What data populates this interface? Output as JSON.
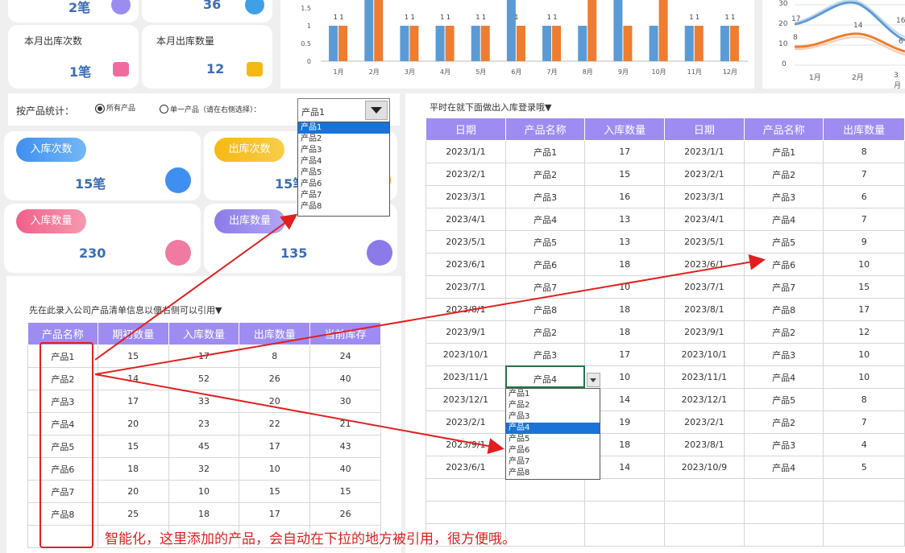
{
  "top_cards": {
    "outbound_count_label": "本月出库次数",
    "outbound_count_value": "1笔",
    "outbound_qty_label": "本月出库数量",
    "outbound_qty_value": "12",
    "cut_left_value": "2笔",
    "cut_right_value": "36"
  },
  "filter": {
    "label": "按产品统计：",
    "option_all": "所有产品",
    "option_single": "单一产品（请在右侧选择）：",
    "selected": "产品1",
    "options": [
      "产品1",
      "产品2",
      "产品3",
      "产品4",
      "产品5",
      "产品6",
      "产品7",
      "产品8"
    ]
  },
  "stats": {
    "in_count_label": "入库次数",
    "in_count_value": "15笔",
    "out_count_label": "出库次数",
    "out_count_value": "15笔",
    "in_qty_label": "入库数量",
    "in_qty_value": "230",
    "out_qty_label": "出库数量",
    "out_qty_value": "135"
  },
  "chart_data": {
    "type": "bar",
    "categories": [
      "1月",
      "2月",
      "3月",
      "4月",
      "5月",
      "6月",
      "7月",
      "8月",
      "9月",
      "10月",
      "11月",
      "12月"
    ],
    "series": [
      {
        "values": [
          1,
          2,
          1,
          1,
          1,
          2,
          1,
          1,
          2,
          1,
          1,
          1
        ],
        "color": "#5b9bd5"
      },
      {
        "values": [
          1,
          2,
          1,
          1,
          1,
          1,
          1,
          2,
          1,
          2,
          1,
          1
        ],
        "color": "#ed7d31"
      }
    ],
    "data_labels": [
      "1 1",
      "",
      "1 1",
      "1 1",
      "1 1",
      "1",
      "1 1",
      "",
      "",
      "",
      "1 1",
      "1 1"
    ],
    "yticks": [
      "1.5",
      "1",
      "0.5",
      "0"
    ],
    "ylim": [
      0,
      2
    ]
  },
  "line_chart": {
    "labels": [
      "17",
      "8",
      "14",
      "16",
      "6"
    ],
    "yticks": [
      "30",
      "20",
      "10",
      "0"
    ],
    "xticks": [
      "1月",
      "2月",
      "3月"
    ]
  },
  "product_section": {
    "title": "先在此录入公司产品清单信息以便右侧可以引用▼",
    "headers": [
      "产品名称",
      "期初数量",
      "入库数量",
      "出库数量",
      "当前库存"
    ],
    "rows": [
      [
        "产品1",
        "15",
        "17",
        "8",
        "24"
      ],
      [
        "产品2",
        "14",
        "52",
        "26",
        "40"
      ],
      [
        "产品3",
        "17",
        "33",
        "20",
        "30"
      ],
      [
        "产品4",
        "20",
        "23",
        "22",
        "21"
      ],
      [
        "产品5",
        "15",
        "45",
        "17",
        "43"
      ],
      [
        "产品6",
        "18",
        "32",
        "10",
        "40"
      ],
      [
        "产品7",
        "20",
        "10",
        "15",
        "15"
      ],
      [
        "产品8",
        "25",
        "18",
        "17",
        "26"
      ]
    ]
  },
  "records_section": {
    "title": "平时在就下面做出入库登录哦▼",
    "headers": [
      "日期",
      "产品名称",
      "入库数量",
      "日期",
      "产品名称",
      "出库数量"
    ],
    "rows": [
      [
        "2023/1/1",
        "产品1",
        "17",
        "2023/1/1",
        "产品1",
        "8"
      ],
      [
        "2023/2/1",
        "产品2",
        "15",
        "2023/2/1",
        "产品2",
        "7"
      ],
      [
        "2023/3/1",
        "产品3",
        "16",
        "2023/3/1",
        "产品3",
        "6"
      ],
      [
        "2023/4/1",
        "产品4",
        "13",
        "2023/4/1",
        "产品4",
        "7"
      ],
      [
        "2023/5/1",
        "产品5",
        "13",
        "2023/5/1",
        "产品5",
        "9"
      ],
      [
        "2023/6/1",
        "产品6",
        "18",
        "2023/6/1",
        "产品6",
        "10"
      ],
      [
        "2023/7/1",
        "产品7",
        "10",
        "2023/7/1",
        "产品7",
        "15"
      ],
      [
        "2023/8/1",
        "产品8",
        "18",
        "2023/8/1",
        "产品8",
        "17"
      ],
      [
        "2023/9/1",
        "产品2",
        "18",
        "2023/9/1",
        "产品2",
        "12"
      ],
      [
        "2023/10/1",
        "产品3",
        "17",
        "2023/10/1",
        "产品3",
        "10"
      ],
      [
        "2023/11/1",
        "产品4",
        "10",
        "2023/11/1",
        "产品4",
        "10"
      ],
      [
        "2023/12/1",
        "",
        "14",
        "2023/12/1",
        "产品5",
        "8"
      ],
      [
        "2023/2/1",
        "",
        "19",
        "2023/2/1",
        "产品2",
        "7"
      ],
      [
        "2023/9/1",
        "",
        "18",
        "2023/8/1",
        "产品3",
        "4"
      ],
      [
        "2023/6/1",
        "",
        "14",
        "2023/10/9",
        "产品4",
        "5"
      ]
    ],
    "cell_dropdown_value": "产品4",
    "cell_dropdown_selected_index": 3
  },
  "annotation": "智能化，这里添加的产品，会自动在下拉的地方被引用，很方便哦。"
}
